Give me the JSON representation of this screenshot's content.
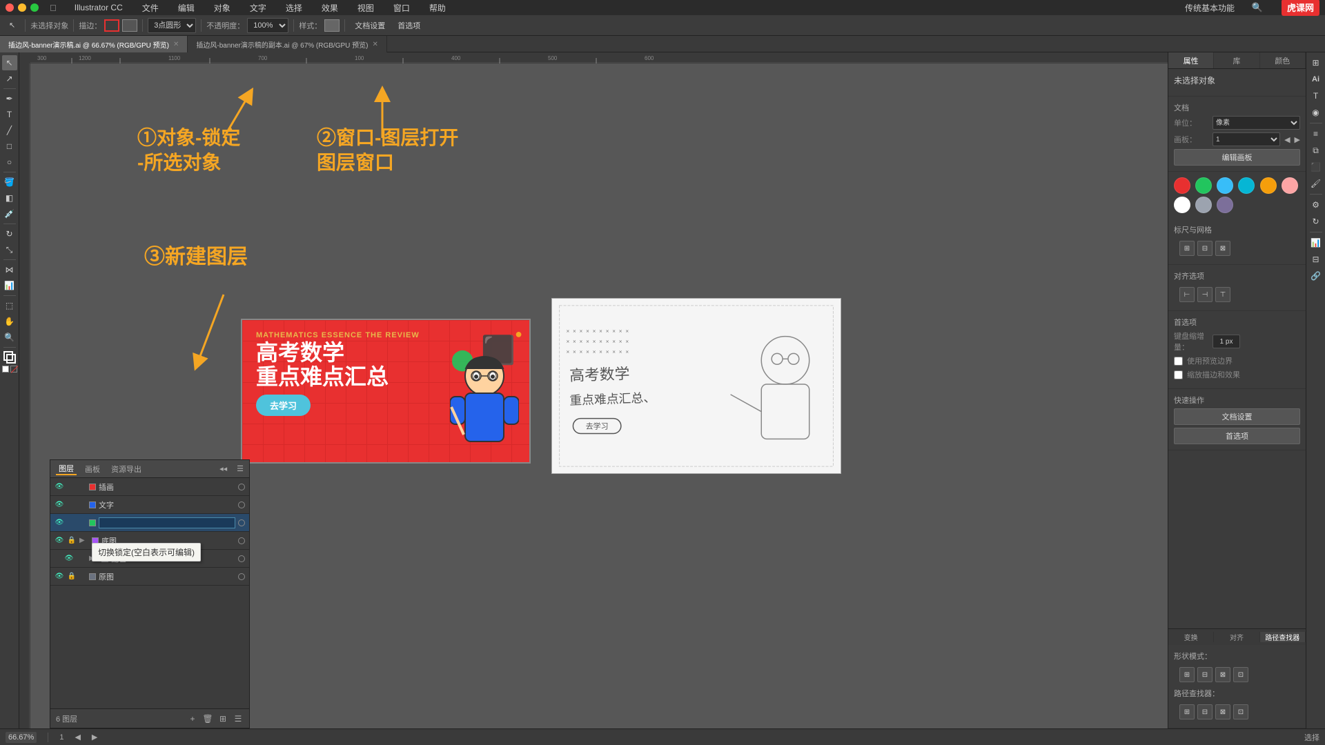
{
  "titlebar": {
    "apple": "&#63743;",
    "menus": [
      "Illustrator CC",
      "文件",
      "编辑",
      "对象",
      "文字",
      "选择",
      "效果",
      "视图",
      "窗口",
      "帮助"
    ],
    "top_right": "传统基本功能"
  },
  "toolbar": {
    "select_label": "未选择对象",
    "stroke_label": "描边：",
    "shape_label": "3点圆形",
    "opacity_label": "不透明度：",
    "opacity_value": "100%",
    "style_label": "样式：",
    "doc_settings": "文档设置",
    "preferences": "首选项"
  },
  "tabs": [
    {
      "name": "插边风-banner演示稿.ai @ 66.67% (RGB/GPU 预览)",
      "active": true
    },
    {
      "name": "插边风-banner演示稿的副本.ai @ 67% (RGB/GPU 预览)",
      "active": false
    }
  ],
  "annotations": {
    "step1": "①对象-锁定\n-所选对象",
    "step2": "②窗口-图层打开\n图层窗口",
    "step3": "③新建图层"
  },
  "layers": {
    "title": "图层",
    "tabs": [
      "图层",
      "画板",
      "资源导出"
    ],
    "items": [
      {
        "name": "插画",
        "visible": true,
        "locked": false,
        "color": "#e83030"
      },
      {
        "name": "文字",
        "visible": true,
        "locked": false,
        "color": "#2563eb"
      },
      {
        "name": "",
        "visible": true,
        "locked": false,
        "color": "#22c55e",
        "editing": true
      },
      {
        "name": "底图",
        "visible": true,
        "locked": true,
        "color": "#a855f7",
        "expanded": true
      },
      {
        "name": "配色",
        "visible": true,
        "locked": false,
        "color": "#f59e0b"
      },
      {
        "name": "原图",
        "visible": true,
        "locked": true,
        "color": "#6b7280"
      }
    ],
    "count": "6 图层",
    "tooltip": "切换锁定(空白表示可编辑)"
  },
  "right_panel": {
    "tabs": [
      "属性",
      "库",
      "颜色"
    ],
    "title": "未选择对象",
    "doc_label": "文档",
    "unit_label": "单位：",
    "unit_value": "像素",
    "artboard_label": "画板：",
    "artboard_value": "1",
    "edit_artboard_btn": "编辑画板",
    "guides_label": "标尺与网格",
    "snapping_label": "对齐选项",
    "preferences_label": "首选项",
    "keyboard_label": "键盘缩增量：",
    "keyboard_value": "1 px",
    "scale_strokes": "缩放描边和效果",
    "use_preview": "使用预览边界",
    "quick_actions": "快速操作",
    "doc_settings_btn": "文档设置",
    "preferences_btn": "首选项",
    "colors": [
      "#e83030",
      "#22c55e",
      "#38bdf8",
      "#38bdf8",
      "#f59e0b",
      "#fca5a5",
      "#ffffff",
      "#9ca3af",
      "#7c6f9a"
    ],
    "bottom_tabs": [
      "变换",
      "对齐",
      "路径查找器"
    ]
  },
  "canvas": {
    "zoom": "66.67%",
    "artboard": "1",
    "tool": "选择",
    "banner_text": {
      "math_label": "MATHEMATICS ESSENCE THE REVIEW",
      "title_line1": "高考数学",
      "title_line2": "重点难点汇总",
      "btn": "去学习"
    }
  },
  "status": {
    "zoom": "66.67%",
    "artboard_num": "1",
    "tool": "选择"
  }
}
